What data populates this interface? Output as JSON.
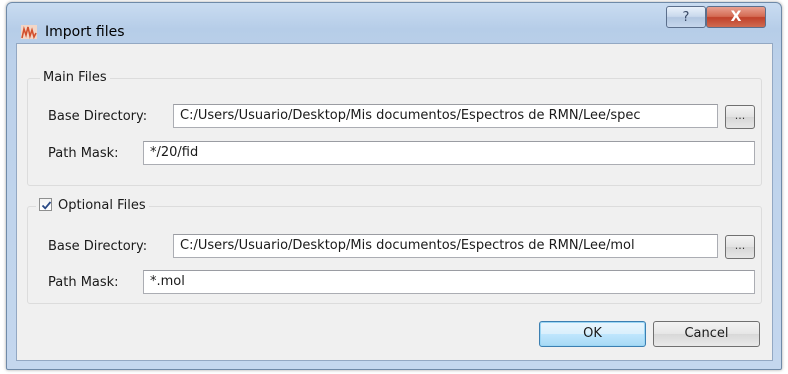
{
  "window": {
    "title": "Import files",
    "help_glyph": "?",
    "close_glyph": "X"
  },
  "main_files": {
    "title": "Main Files",
    "base_directory_label": "Base Directory:",
    "base_directory_value": "C:/Users/Usuario/Desktop/Mis documentos/Espectros de RMN/Lee/spec",
    "browse_label": "...",
    "path_mask_label": "Path Mask:",
    "path_mask_value": "*/20/fid"
  },
  "optional_files": {
    "title": "Optional Files",
    "checked": true,
    "base_directory_label": "Base Directory:",
    "base_directory_value": "C:/Users/Usuario/Desktop/Mis documentos/Espectros de RMN/Lee/mol",
    "browse_label": "...",
    "path_mask_label": "Path Mask:",
    "path_mask_value": "*.mol"
  },
  "buttons": {
    "ok": "OK",
    "cancel": "Cancel"
  },
  "colors": {
    "title_bar": "#b6cde8",
    "close_button": "#c0402a",
    "default_button_border": "#3c7fb1"
  }
}
